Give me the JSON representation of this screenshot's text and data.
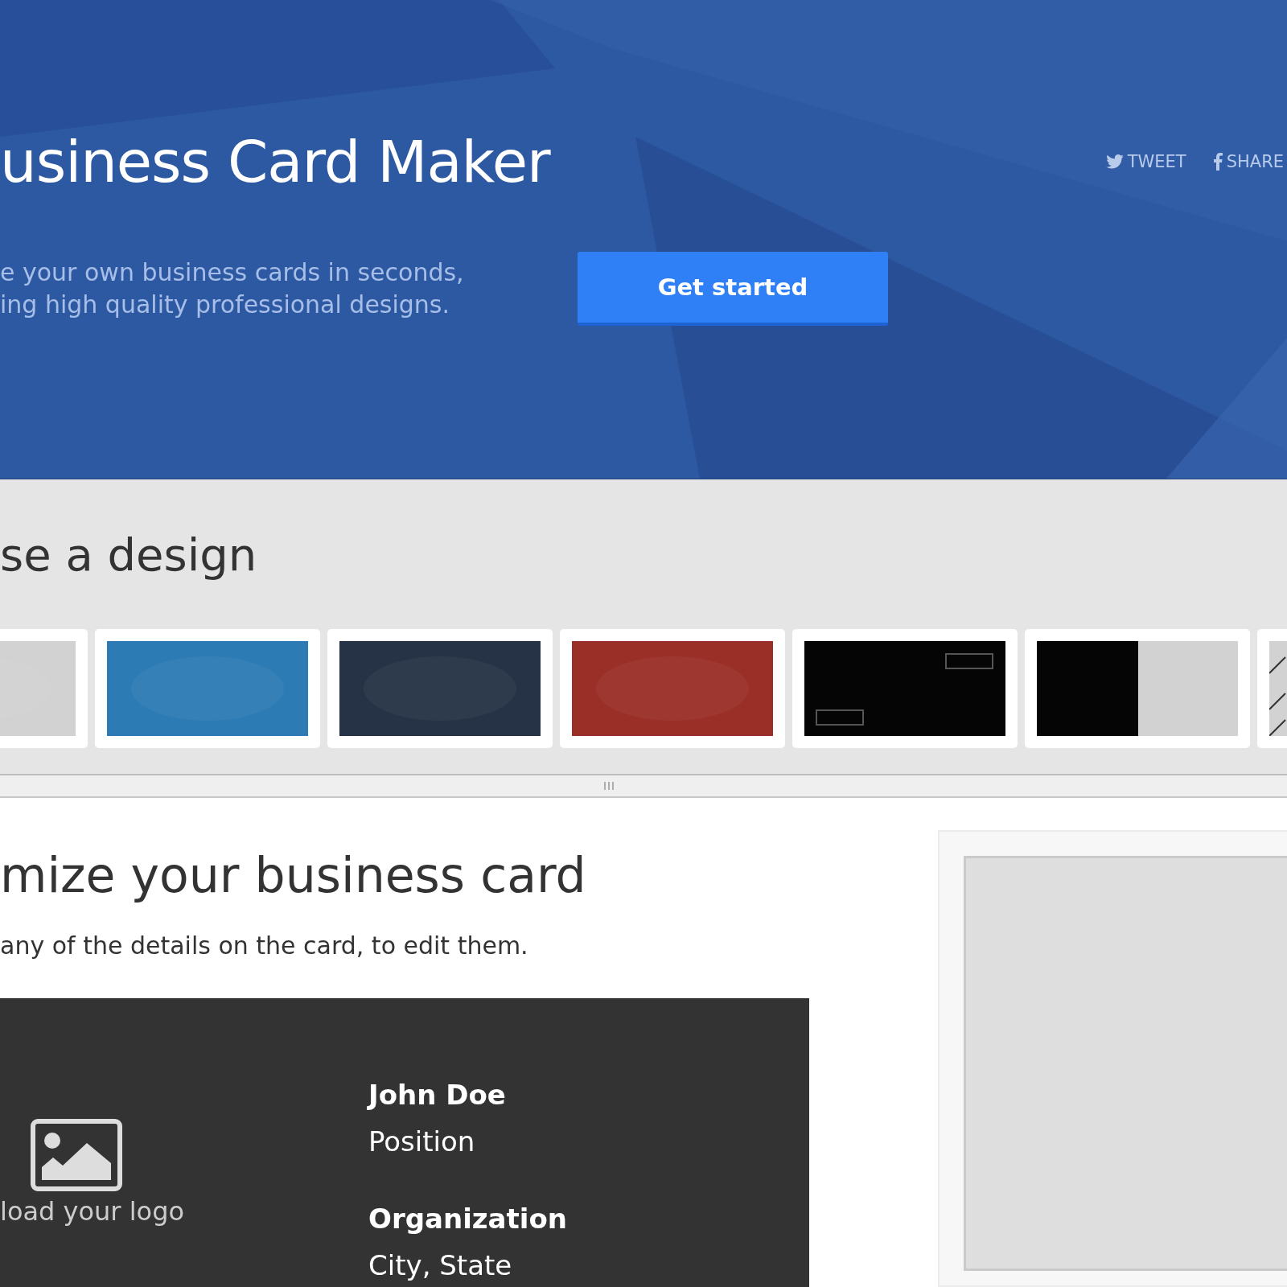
{
  "hero": {
    "title": "usiness Card Maker",
    "share_links": [
      {
        "kind": "twitter",
        "label": "TWEET"
      },
      {
        "kind": "facebook",
        "label": "SHARE"
      }
    ],
    "subtitle_lines": [
      "e your own business cards in seconds,",
      "ing high quality professional designs."
    ],
    "cta_button": "Get started"
  },
  "designs": {
    "heading": "se a design",
    "thumbnails": [
      {
        "kind": "plain",
        "color": "#d2d2d2"
      },
      {
        "kind": "plain",
        "color": "#2d7bb4"
      },
      {
        "kind": "plain",
        "color": "#263346"
      },
      {
        "kind": "plain",
        "color": "#9a2f27"
      },
      {
        "kind": "frames",
        "color": "#050505"
      },
      {
        "kind": "split",
        "color": "#050505"
      },
      {
        "kind": "stripes",
        "color": "#d2d2d2"
      }
    ]
  },
  "customize": {
    "heading": "mize your business card",
    "instruction": "any of the details on the card, to edit them.",
    "card": {
      "logo_label": "load your logo",
      "name": "John Doe",
      "position": "Position",
      "organization": "Organization",
      "location": "City, State"
    }
  }
}
